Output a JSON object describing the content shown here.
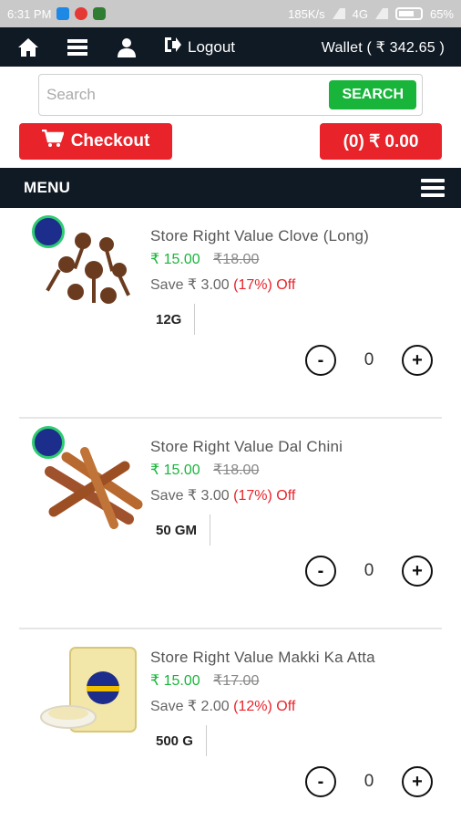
{
  "statusbar": {
    "time": "6:31 PM",
    "network_speed": "185K/s",
    "network_type": "4G",
    "battery": "65%"
  },
  "topnav": {
    "logout_label": "Logout",
    "wallet_label": "Wallet ( ₹ 342.65 )"
  },
  "search": {
    "placeholder": "Search",
    "button_label": "SEARCH"
  },
  "actions": {
    "checkout_label": "Checkout",
    "cart_total": "(0) ₹ 0.00"
  },
  "menubar": {
    "label": "MENU"
  },
  "products": [
    {
      "name": "Store Right Value Clove (Long)",
      "price": "₹ 15.00",
      "mrp": "₹18.00",
      "save_text": "Save ₹ 3.00",
      "save_pct": "(17%) Off",
      "weight": "12G",
      "qty": "0",
      "minus": "-",
      "plus": "+"
    },
    {
      "name": "Store Right Value Dal Chini",
      "price": "₹ 15.00",
      "mrp": "₹18.00",
      "save_text": "Save ₹ 3.00",
      "save_pct": "(17%) Off",
      "weight": "50 GM",
      "qty": "0",
      "minus": "-",
      "plus": "+"
    },
    {
      "name": "Store Right Value Makki Ka Atta",
      "price": "₹ 15.00",
      "mrp": "₹17.00",
      "save_text": "Save ₹ 2.00",
      "save_pct": "(12%) Off",
      "weight": "500 G",
      "qty": "0",
      "minus": "-",
      "plus": "+"
    }
  ],
  "colors": {
    "navy": "#101a24",
    "green": "#18b53a",
    "red": "#e8232a"
  }
}
